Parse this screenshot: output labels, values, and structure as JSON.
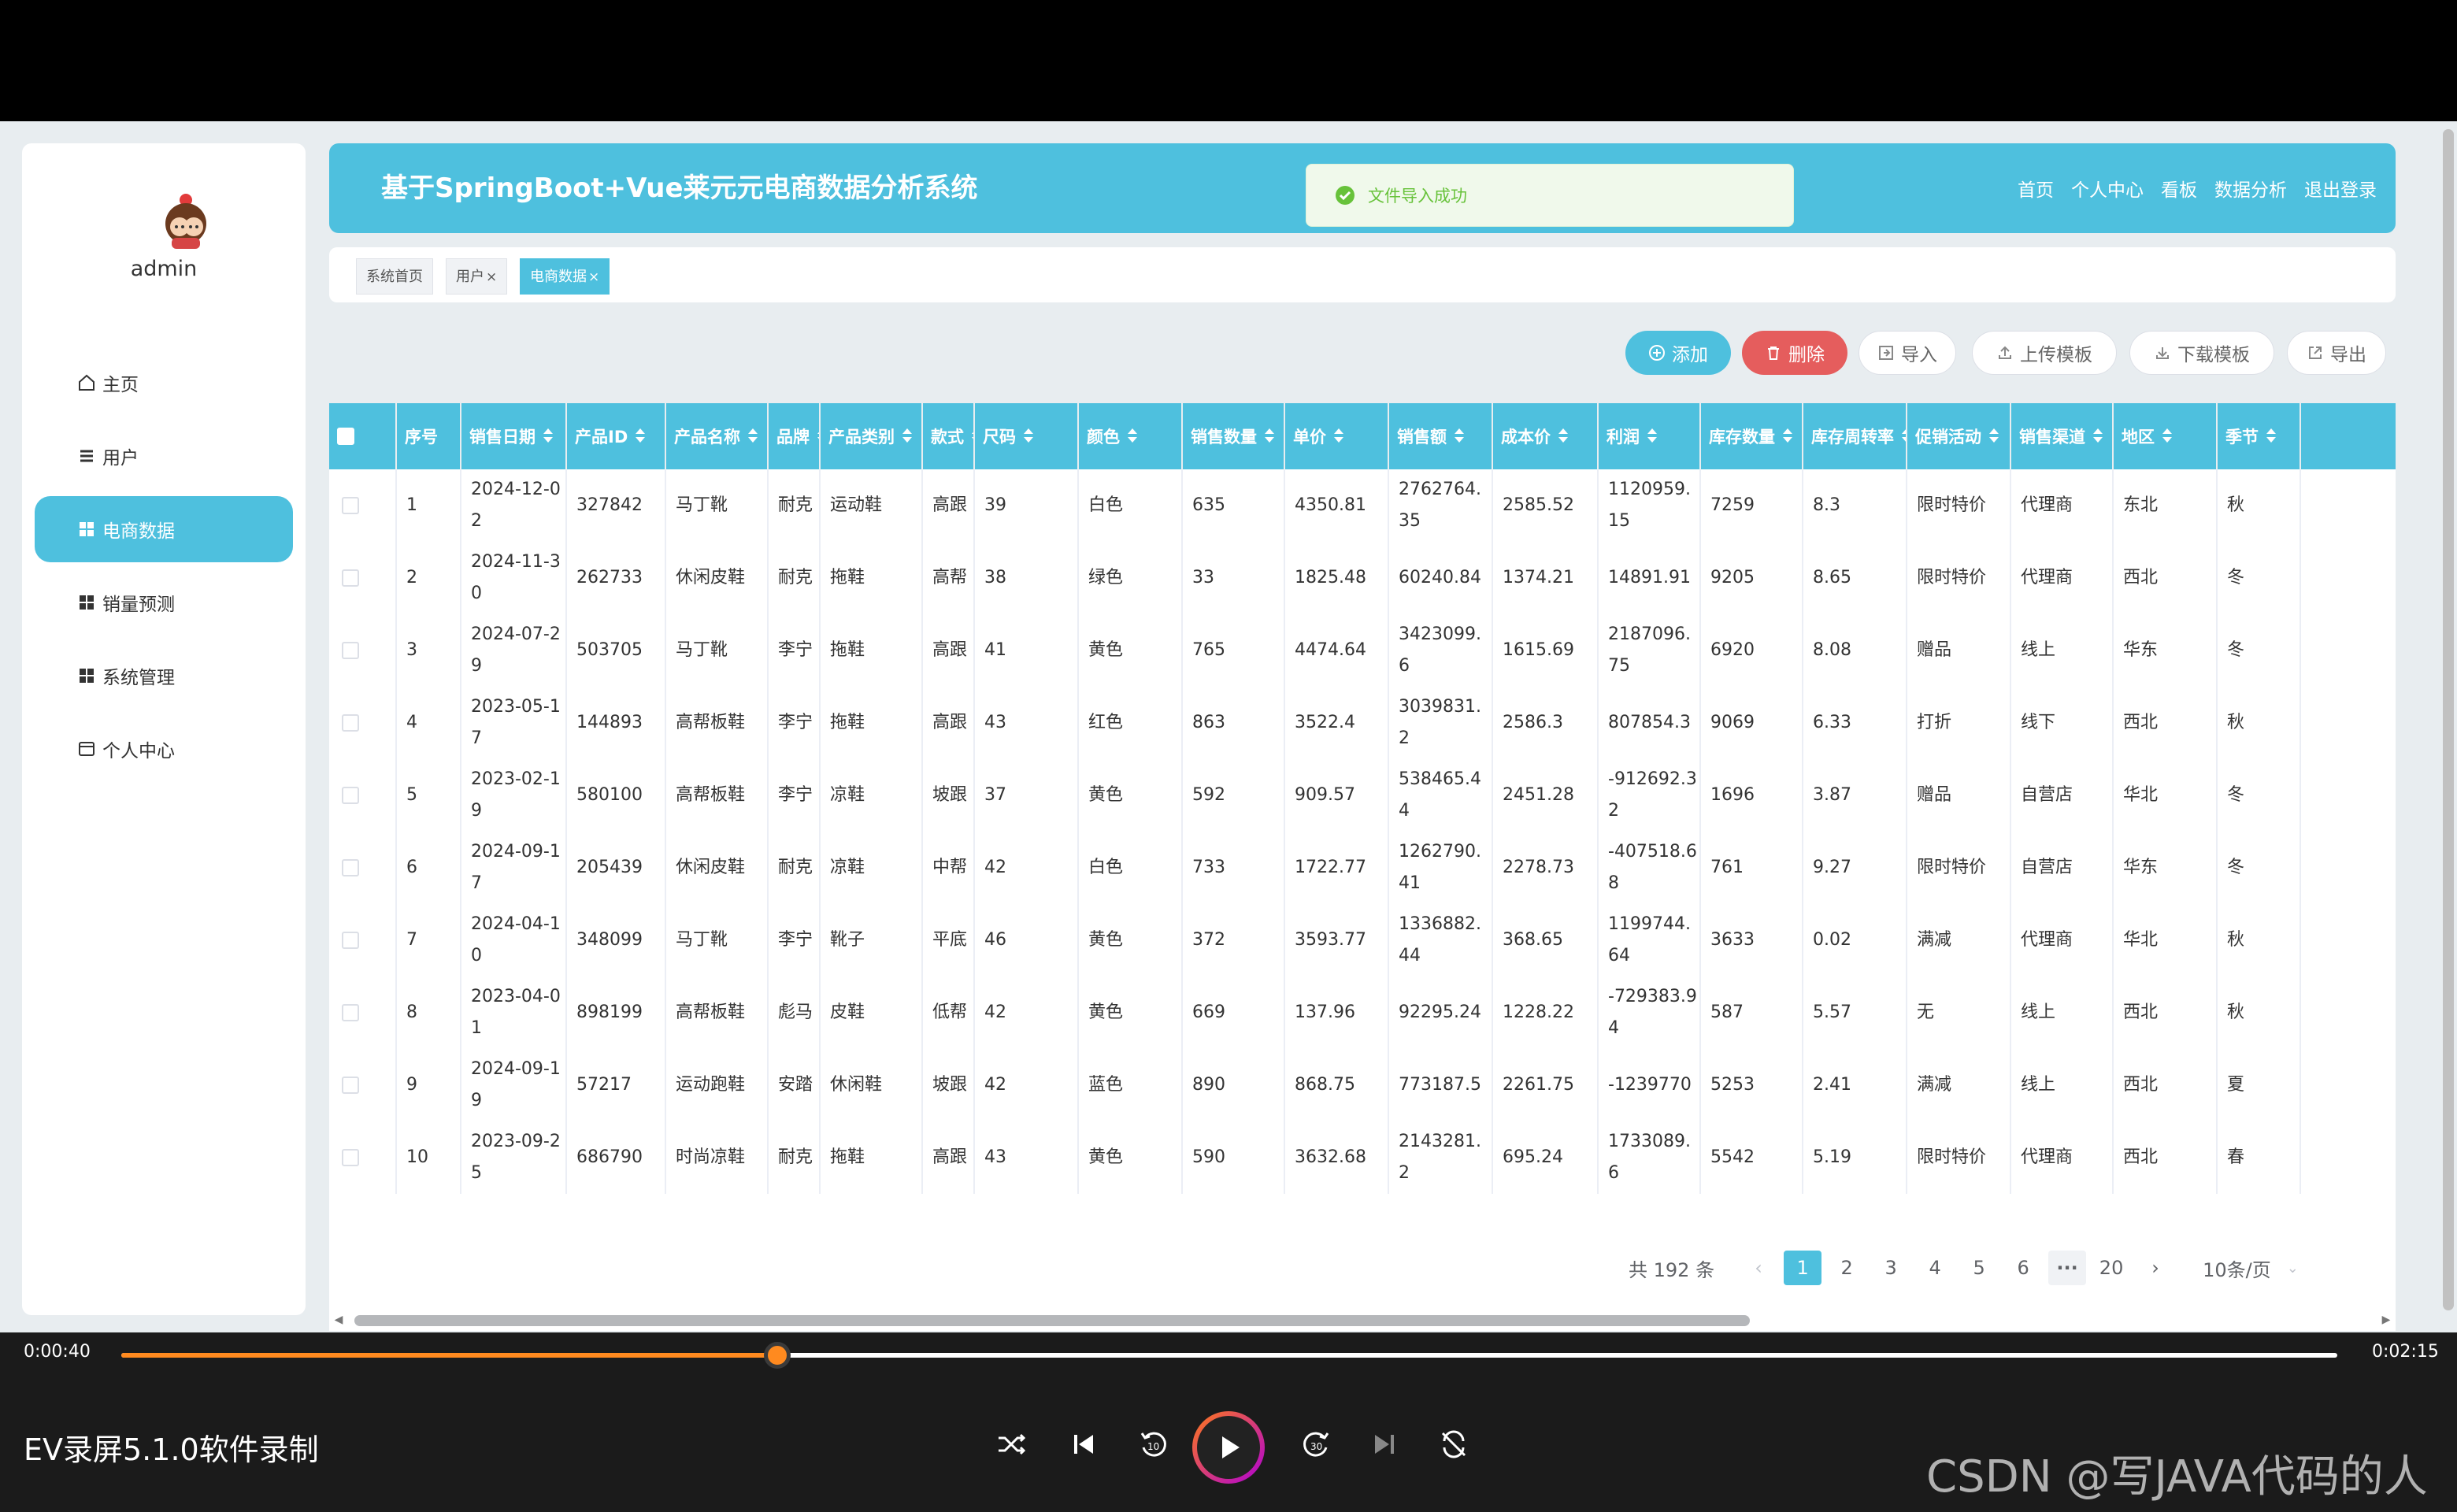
{
  "user": {
    "name": "admin"
  },
  "sidebar": {
    "items": [
      {
        "label": "主页",
        "icon": "home-icon",
        "active": false
      },
      {
        "label": "用户",
        "icon": "list-icon",
        "active": false
      },
      {
        "label": "电商数据",
        "icon": "grid-icon",
        "active": true
      },
      {
        "label": "销量预测",
        "icon": "grid-icon",
        "active": false
      },
      {
        "label": "系统管理",
        "icon": "grid-icon",
        "active": false
      },
      {
        "label": "个人中心",
        "icon": "card-icon",
        "active": false
      }
    ]
  },
  "header": {
    "title": "基于SpringBoot+Vue莱元元电商数据分析系统",
    "nav": [
      "首页",
      "个人中心",
      "看板",
      "数据分析",
      "退出登录"
    ]
  },
  "toast": {
    "message": "文件导入成功",
    "type": "success"
  },
  "tabs": [
    {
      "label": "系统首页",
      "closable": false,
      "active": false
    },
    {
      "label": "用户",
      "closable": true,
      "active": false
    },
    {
      "label": "电商数据",
      "closable": true,
      "active": true
    }
  ],
  "toolbar": {
    "add": "添加",
    "delete": "删除",
    "import": "导入",
    "upload_template": "上传模板",
    "download_template": "下载模板",
    "export": "导出"
  },
  "table": {
    "columns": [
      "序号",
      "销售日期",
      "产品ID",
      "产品名称",
      "品牌",
      "产品类别",
      "款式",
      "尺码",
      "颜色",
      "销售数量",
      "单价",
      "销售额",
      "成本价",
      "利润",
      "库存数量",
      "库存周转率",
      "促销活动",
      "销售渠道",
      "地区",
      "季节"
    ],
    "rows": [
      [
        "1",
        "2024-12-02",
        "327842",
        "马丁靴",
        "耐克",
        "运动鞋",
        "高跟",
        "39",
        "白色",
        "635",
        "4350.81",
        "2762764.35",
        "2585.52",
        "1120959.15",
        "7259",
        "8.3",
        "限时特价",
        "代理商",
        "东北",
        "秋"
      ],
      [
        "2",
        "2024-11-30",
        "262733",
        "休闲皮鞋",
        "耐克",
        "拖鞋",
        "高帮",
        "38",
        "绿色",
        "33",
        "1825.48",
        "60240.84",
        "1374.21",
        "14891.91",
        "9205",
        "8.65",
        "限时特价",
        "代理商",
        "西北",
        "冬"
      ],
      [
        "3",
        "2024-07-29",
        "503705",
        "马丁靴",
        "李宁",
        "拖鞋",
        "高跟",
        "41",
        "黄色",
        "765",
        "4474.64",
        "3423099.6",
        "1615.69",
        "2187096.75",
        "6920",
        "8.08",
        "赠品",
        "线上",
        "华东",
        "冬"
      ],
      [
        "4",
        "2023-05-17",
        "144893",
        "高帮板鞋",
        "李宁",
        "拖鞋",
        "高跟",
        "43",
        "红色",
        "863",
        "3522.4",
        "3039831.2",
        "2586.3",
        "807854.3",
        "9069",
        "6.33",
        "打折",
        "线下",
        "西北",
        "秋"
      ],
      [
        "5",
        "2023-02-19",
        "580100",
        "高帮板鞋",
        "李宁",
        "凉鞋",
        "坡跟",
        "37",
        "黄色",
        "592",
        "909.57",
        "538465.44",
        "2451.28",
        "-912692.32",
        "1696",
        "3.87",
        "赠品",
        "自营店",
        "华北",
        "冬"
      ],
      [
        "6",
        "2024-09-17",
        "205439",
        "休闲皮鞋",
        "耐克",
        "凉鞋",
        "中帮",
        "42",
        "白色",
        "733",
        "1722.77",
        "1262790.41",
        "2278.73",
        "-407518.68",
        "761",
        "9.27",
        "限时特价",
        "自营店",
        "华东",
        "冬"
      ],
      [
        "7",
        "2024-04-10",
        "348099",
        "马丁靴",
        "李宁",
        "靴子",
        "平底",
        "46",
        "黄色",
        "372",
        "3593.77",
        "1336882.44",
        "368.65",
        "1199744.64",
        "3633",
        "0.02",
        "满减",
        "代理商",
        "华北",
        "秋"
      ],
      [
        "8",
        "2023-04-01",
        "898199",
        "高帮板鞋",
        "彪马",
        "皮鞋",
        "低帮",
        "42",
        "黄色",
        "669",
        "137.96",
        "92295.24",
        "1228.22",
        "-729383.94",
        "587",
        "5.57",
        "无",
        "线上",
        "西北",
        "秋"
      ],
      [
        "9",
        "2024-09-19",
        "57217",
        "运动跑鞋",
        "安踏",
        "休闲鞋",
        "坡跟",
        "42",
        "蓝色",
        "890",
        "868.75",
        "773187.5",
        "2261.75",
        "-1239770",
        "5253",
        "2.41",
        "满减",
        "线上",
        "西北",
        "夏"
      ],
      [
        "10",
        "2023-09-25",
        "686790",
        "时尚凉鞋",
        "耐克",
        "拖鞋",
        "高跟",
        "43",
        "黄色",
        "590",
        "3632.68",
        "2143281.2",
        "695.24",
        "1733089.6",
        "5542",
        "5.19",
        "限时特价",
        "代理商",
        "西北",
        "春"
      ]
    ]
  },
  "pagination": {
    "total_text": "共 192 条",
    "prev": "‹",
    "next": "›",
    "pages": [
      "1",
      "2",
      "3",
      "4",
      "5",
      "6",
      "···",
      "20"
    ],
    "current": "1",
    "page_size": "10条/页"
  },
  "player": {
    "current_time": "0:00:40",
    "total_time": "0:02:15",
    "progress": 0.296,
    "app_name": "EV录屏5.1.0软件录制"
  },
  "watermark": "CSDN @写JAVA代码的人",
  "colors": {
    "accent": "#4ec0de",
    "danger": "#e55d5d",
    "progress": "#ff8a1f",
    "success": "#67c23a"
  }
}
